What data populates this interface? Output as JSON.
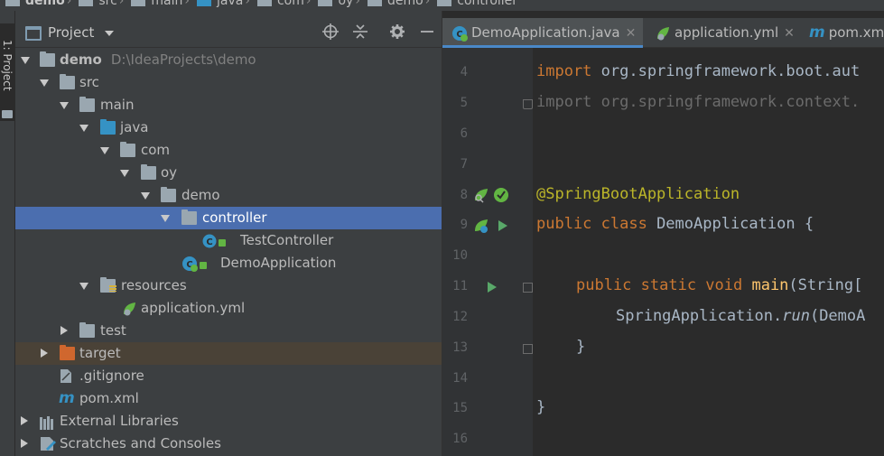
{
  "breadcrumb": [
    "demo",
    "src",
    "main",
    "java",
    "com",
    "oy",
    "demo",
    "controller"
  ],
  "stripe": {
    "label": "1: Project"
  },
  "panel": {
    "title": "Project"
  },
  "tree": [
    {
      "label": "demo",
      "path": "D:\\IdeaProjects\\demo"
    },
    {
      "label": "src"
    },
    {
      "label": "main"
    },
    {
      "label": "java"
    },
    {
      "label": "com"
    },
    {
      "label": "oy"
    },
    {
      "label": "demo"
    },
    {
      "label": "controller"
    },
    {
      "label": "TestController"
    },
    {
      "label": "DemoApplication"
    },
    {
      "label": "resources"
    },
    {
      "label": "application.yml"
    },
    {
      "label": "test"
    },
    {
      "label": "target"
    },
    {
      "label": ".gitignore"
    },
    {
      "label": "pom.xml"
    },
    {
      "label": "External Libraries"
    },
    {
      "label": "Scratches and Consoles"
    }
  ],
  "tabs": [
    {
      "label": "DemoApplication.java"
    },
    {
      "label": "application.yml"
    },
    {
      "label": "pom.xml"
    }
  ],
  "line_numbers": [
    "4",
    "5",
    "6",
    "7",
    "8",
    "9",
    "10",
    "11",
    "12",
    "13",
    "14",
    "15",
    "16"
  ],
  "code": {
    "l4_kw": "import ",
    "l4_rest": "org.springframework.boot.aut",
    "l5": "import org.springframework.context.",
    "l8": "@SpringBootApplication",
    "l9_kw": "public class ",
    "l9_rest": "DemoApplication {",
    "l11_kw": "public static void ",
    "l11_fn": "main",
    "l11_rest": "(String[",
    "l12_a": "SpringApplication.",
    "l12_run": "run",
    "l12_b": "(DemoA",
    "l13": "}",
    "l15": "}"
  },
  "colors": {
    "selection": "#4b6eaf",
    "keyword": "#cc7832",
    "annotation": "#bbb529",
    "method": "#ffc66d",
    "folder_source": "#3592c4",
    "folder_excluded": "#d0672e"
  }
}
